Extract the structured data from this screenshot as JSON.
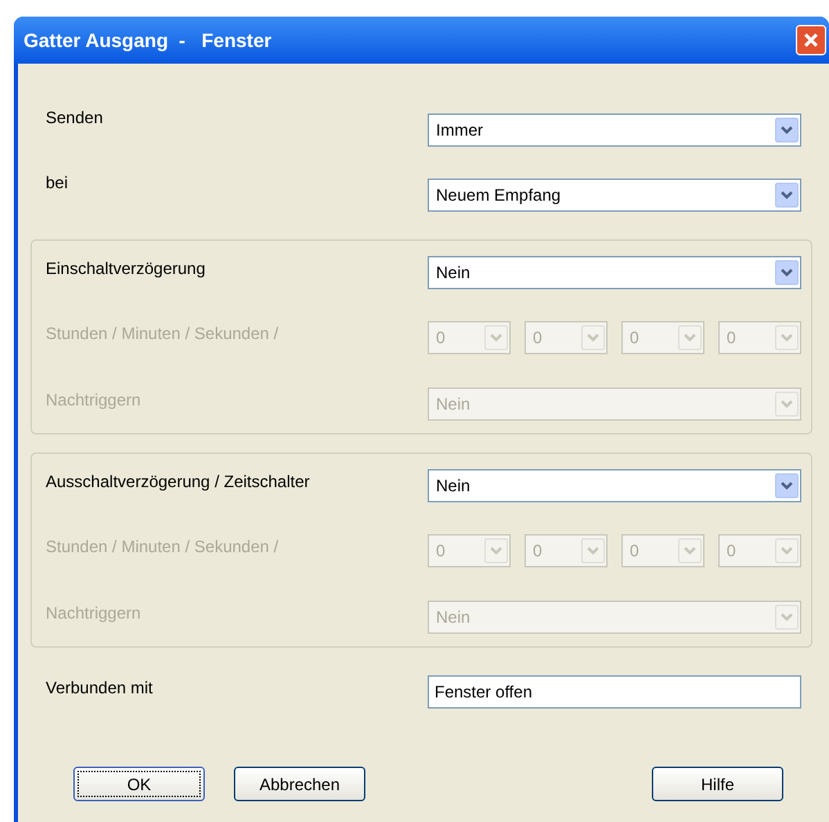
{
  "window": {
    "title": "Gatter Ausgang  -   Fenster"
  },
  "rows": [
    {
      "label": "Senden",
      "value": "Immer",
      "disabled": false
    },
    {
      "label": "bei",
      "value": "Neuem Empfang",
      "disabled": false
    }
  ],
  "groups": [
    {
      "label": "Einschaltverzögerung",
      "value": "Nein",
      "disabled": false,
      "time_label": "Stunden / Minuten / Sekunden /",
      "time_disabled": true,
      "time_values": [
        "0",
        "0",
        "0",
        "0"
      ],
      "retrigger_label": "Nachtriggern",
      "retrigger_value": "Nein",
      "retrigger_disabled": true
    },
    {
      "label": "Ausschaltverzögerung / Zeitschalter",
      "value": "Nein",
      "disabled": false,
      "time_label": "Stunden / Minuten / Sekunden /",
      "time_disabled": true,
      "time_values": [
        "0",
        "0",
        "0",
        "0"
      ],
      "retrigger_label": "Nachtriggern",
      "retrigger_value": "Nein",
      "retrigger_disabled": true
    }
  ],
  "connected": {
    "label": "Verbunden mit",
    "value": "Fenster offen"
  },
  "buttons": [
    {
      "label": "OK",
      "default": true
    },
    {
      "label": "Abbrechen",
      "default": false
    },
    {
      "label": "Hilfe",
      "default": false
    }
  ]
}
